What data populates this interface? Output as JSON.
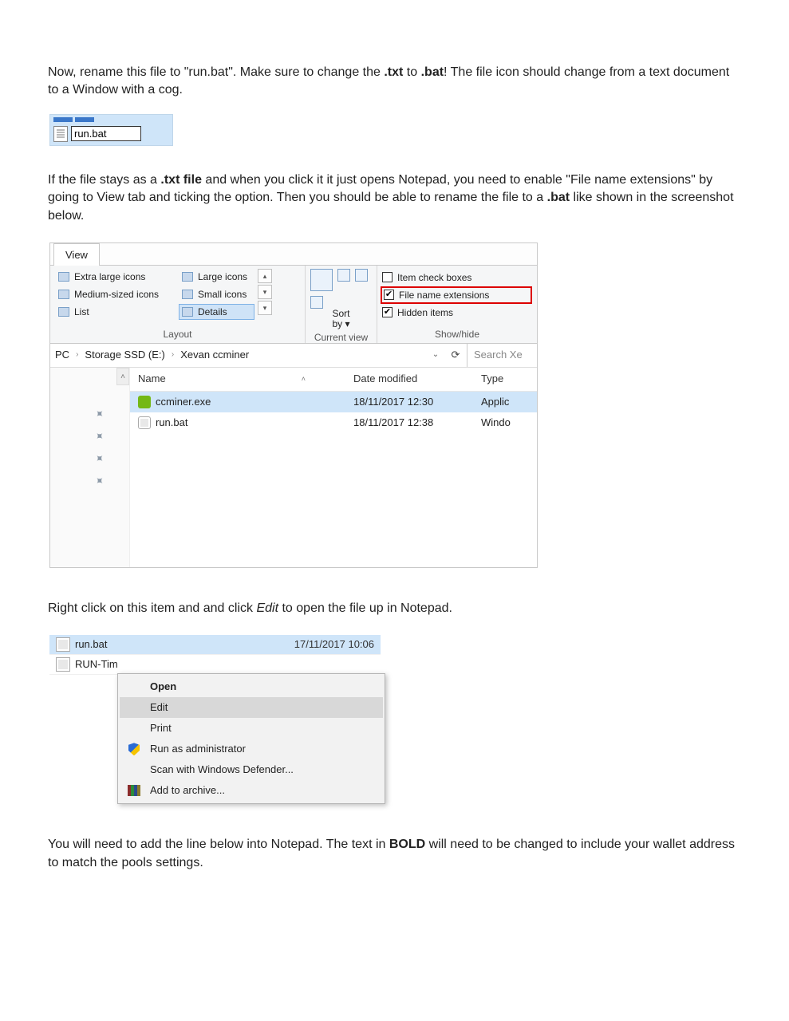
{
  "para1": {
    "seg1": "Now, rename this file to \"run.bat\". Make sure to change the ",
    "b1": ".txt",
    "seg2": " to ",
    "b2": ".bat",
    "seg3": "! The file icon should change from a text document to a Window with a cog."
  },
  "rename_input": "run.bat",
  "para2": {
    "seg1": "If the file stays as a ",
    "b1": ".txt file",
    "seg2": " and when you click it it just opens Notepad, you need to enable \"File name extensions\" by going to View tab and ticking the option. Then you should be able to rename the file to a ",
    "b2": ".bat",
    "seg3": " like shown in the screenshot below."
  },
  "explorer": {
    "tab": "View",
    "layout": {
      "items": [
        "Extra large icons",
        "Large icons",
        "Medium-sized icons",
        "Small icons",
        "List",
        "Details"
      ],
      "label": "Layout"
    },
    "current_view": {
      "sort": "Sort by",
      "label": "Current view"
    },
    "showhide": {
      "item_check_boxes": "Item check boxes",
      "file_name_ext": "File name extensions",
      "hidden_items": "Hidden items",
      "label": "Show/hide"
    },
    "breadcrumb": {
      "pc": "PC",
      "drive": "Storage SSD (E:)",
      "folder": "Xevan ccminer"
    },
    "search_placeholder": "Search Xe",
    "columns": {
      "name": "Name",
      "date": "Date modified",
      "type": "Type"
    },
    "files": [
      {
        "name": "ccminer.exe",
        "date": "18/11/2017 12:30",
        "type": "Applic"
      },
      {
        "name": "run.bat",
        "date": "18/11/2017 12:38",
        "type": "Windo"
      }
    ]
  },
  "para3": {
    "seg1": "Right click on this item and and click ",
    "i1": "Edit",
    "seg2": " to open the file up in Notepad."
  },
  "context": {
    "files": [
      {
        "name": "run.bat",
        "date": "17/11/2017 10:06"
      },
      {
        "name": "RUN-Tim",
        "date": ""
      }
    ],
    "menu": {
      "open": "Open",
      "edit": "Edit",
      "print": "Print",
      "run_admin": "Run as administrator",
      "scan": "Scan with Windows Defender...",
      "archive": "Add to archive..."
    }
  },
  "para4": {
    "seg1": "You will need to add the line below into Notepad. The text in ",
    "b1": "BOLD",
    "seg2": " will need to be changed to include your wallet address to match the pools settings."
  }
}
